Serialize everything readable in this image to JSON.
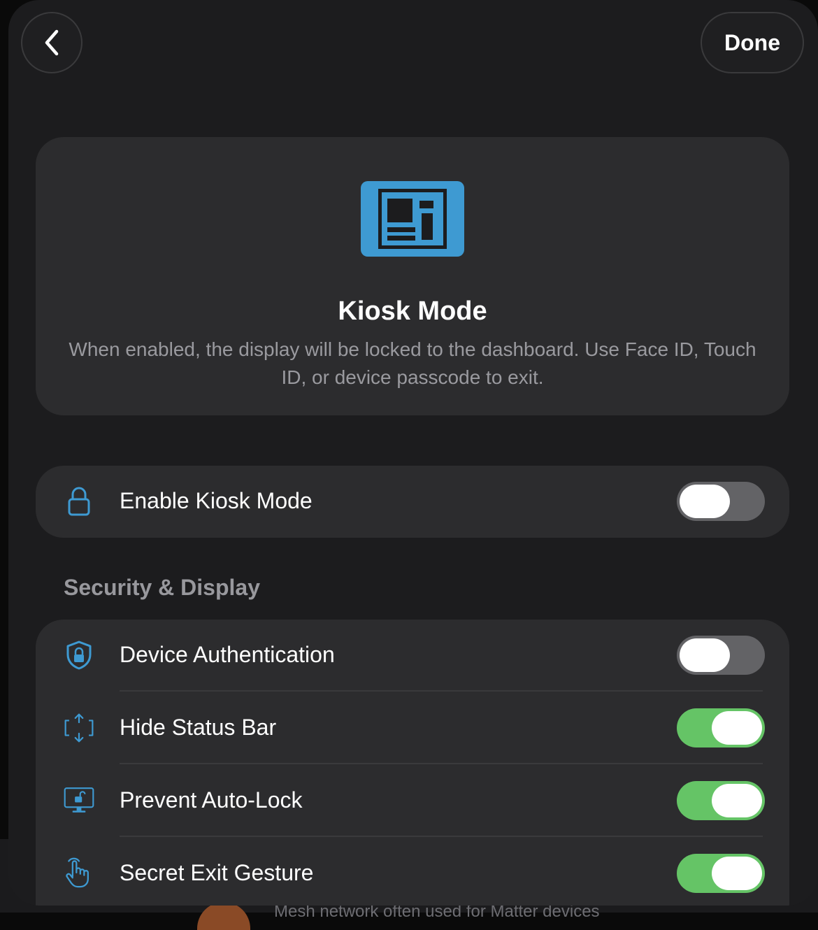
{
  "nav": {
    "back_icon": "chevron-left-icon",
    "done_label": "Done"
  },
  "hero": {
    "icon": "kiosk-display-icon",
    "title": "Kiosk Mode",
    "description": "When enabled, the display will be locked to the dashboard. Use Face ID, Touch ID, or device passcode to exit."
  },
  "enable_row": {
    "icon": "lock-icon",
    "label": "Enable Kiosk Mode",
    "enabled": false
  },
  "security_section": {
    "header": "Security & Display",
    "rows": [
      {
        "icon": "shield-lock-icon",
        "label": "Device Authentication",
        "enabled": false
      },
      {
        "icon": "expand-arrows-icon",
        "label": "Hide Status Bar",
        "enabled": true
      },
      {
        "icon": "monitor-unlock-icon",
        "label": "Prevent Auto-Lock",
        "enabled": true
      },
      {
        "icon": "hand-tap-icon",
        "label": "Secret Exit Gesture",
        "enabled": true
      }
    ]
  },
  "background_page": {
    "partial_text": "Mesh network often used for Matter devices"
  },
  "colors": {
    "accent_blue": "#3e9ad2",
    "toggle_on": "#65c466",
    "toggle_off": "#636366",
    "card_bg": "#2c2c2e",
    "sheet_bg": "#1c1c1e"
  }
}
